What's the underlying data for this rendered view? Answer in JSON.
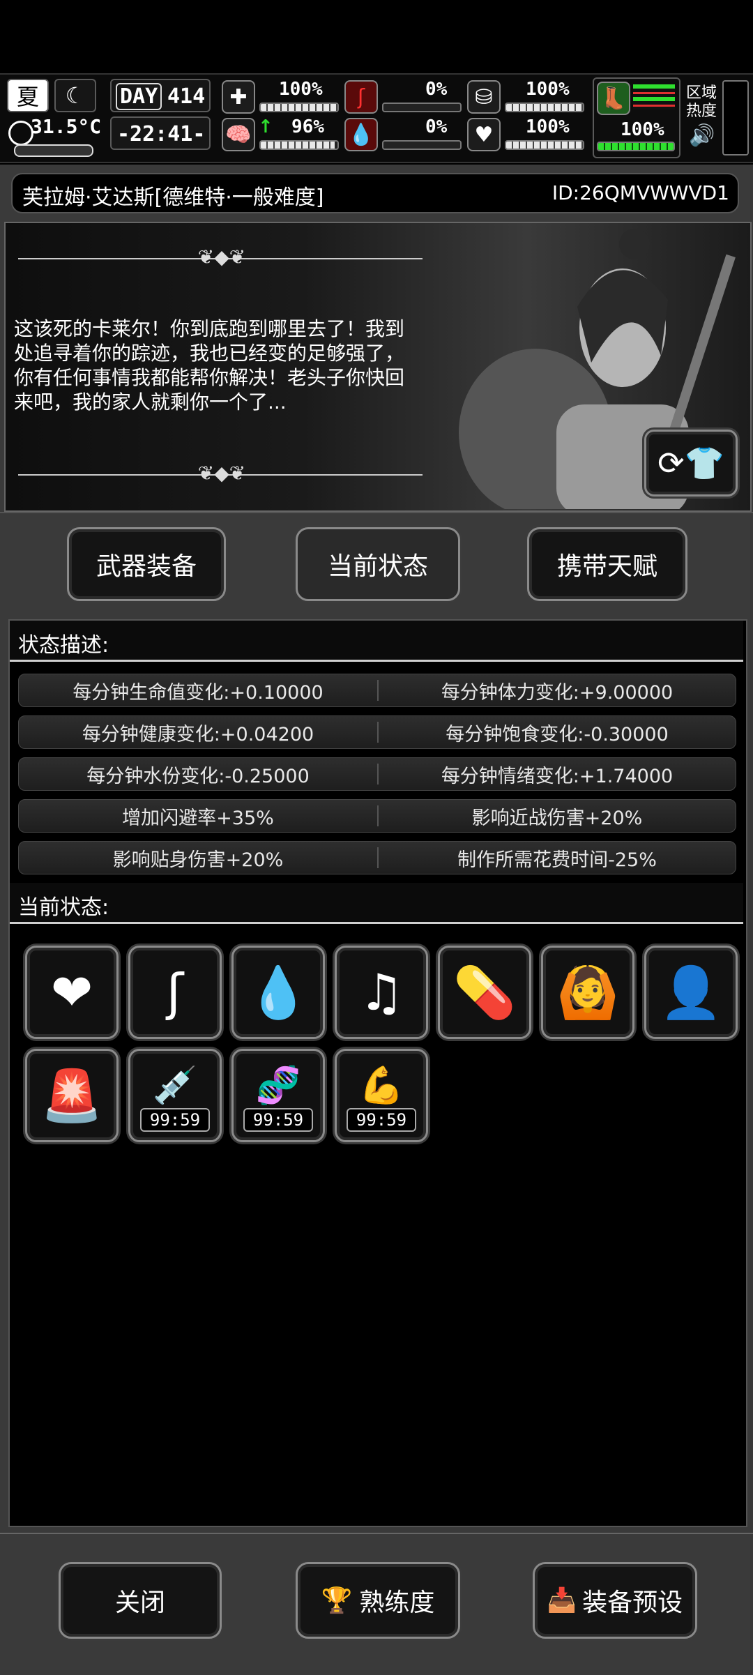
{
  "hud": {
    "season": "夏",
    "temperature": "31.5°C",
    "day_label": "DAY",
    "day_number": "414",
    "time": "-22:41-",
    "stats": [
      {
        "name": "health-kit",
        "value": "100%",
        "fill": 1.0
      },
      {
        "name": "stomach",
        "value": "0%",
        "fill": 0.0
      },
      {
        "name": "bladder",
        "value": "100%",
        "fill": 1.0
      },
      {
        "name": "brain",
        "value": "96%",
        "fill": 0.96
      },
      {
        "name": "blood",
        "value": "0%",
        "fill": 0.0
      },
      {
        "name": "heart",
        "value": "100%",
        "fill": 1.0
      }
    ],
    "stamina_value": "100%",
    "region_label": "区域\n热度"
  },
  "character": {
    "name": "芙拉姆·艾达斯[德维特·一般难度]",
    "id": "ID:26QMVWWVD1",
    "quote": "这该死的卡莱尔！你到底跑到哪里去了！我到处追寻着你的踪迹，我也已经变的足够强了，你有任何事情我都能帮你解决！老头子你快回来吧，我的家人就剩你一个了..."
  },
  "tabs": {
    "weapons": "武器装备",
    "status": "当前状态",
    "talents": "携带天赋"
  },
  "status_desc": {
    "header": "状态描述:",
    "rows": [
      [
        "每分钟生命值变化:+0.10000",
        "每分钟体力变化:+9.00000"
      ],
      [
        "每分钟健康变化:+0.04200",
        "每分钟饱食变化:-0.30000"
      ],
      [
        "每分钟水份变化:-0.25000",
        "每分钟情绪变化:+1.74000"
      ],
      [
        "增加闪避率+35%",
        "影响近战伤害+20%"
      ],
      [
        "影响贴身伤害+20%",
        "制作所需花费时间-25%"
      ]
    ]
  },
  "current_status": {
    "header": "当前状态:",
    "icons": [
      {
        "icon": "heart-icon",
        "glyph": "❤",
        "timer": ""
      },
      {
        "icon": "stomach-icon",
        "glyph": "ʃ",
        "timer": ""
      },
      {
        "icon": "water-drop-icon",
        "glyph": "💧",
        "timer": ""
      },
      {
        "icon": "music-heart-icon",
        "glyph": "♫",
        "timer": ""
      },
      {
        "icon": "medicine-icon",
        "glyph": "💊",
        "timer": ""
      },
      {
        "icon": "stretch-icon",
        "glyph": "🙆",
        "timer": ""
      },
      {
        "icon": "head-icon",
        "glyph": "👤",
        "timer": ""
      },
      {
        "icon": "alarm-person-icon",
        "glyph": "🚨",
        "timer": ""
      },
      {
        "icon": "syringe-icon",
        "glyph": "💉",
        "timer": "99:59"
      },
      {
        "icon": "dna-icon",
        "glyph": "🧬",
        "timer": "99:59"
      },
      {
        "icon": "arm-injection-icon",
        "glyph": "💪",
        "timer": "99:59"
      }
    ]
  },
  "footer": {
    "close": "关闭",
    "proficiency": "熟练度",
    "preset": "装备预设"
  }
}
